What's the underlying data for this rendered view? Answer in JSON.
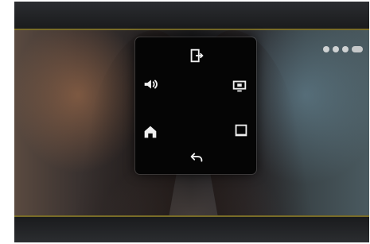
{
  "status": {
    "icons": [
      "status-dot-icon",
      "status-dot-icon",
      "status-dot-icon",
      "status-pill-icon"
    ]
  },
  "menu": {
    "items": [
      {
        "name": "exit",
        "icon": "exit-icon",
        "label": ""
      },
      {
        "name": "audio",
        "icon": "speaker-icon",
        "label": ""
      },
      {
        "name": "display",
        "icon": "display-icon",
        "label": ""
      },
      {
        "name": "home",
        "icon": "home-icon",
        "label": ""
      },
      {
        "name": "screen",
        "icon": "screen-icon",
        "label": ""
      },
      {
        "name": "back",
        "icon": "back-icon",
        "label": ""
      }
    ]
  },
  "colors": {
    "accent_line": "#8a7a2a",
    "menu_bg": "#050505",
    "icon": "#f0f0f0"
  }
}
